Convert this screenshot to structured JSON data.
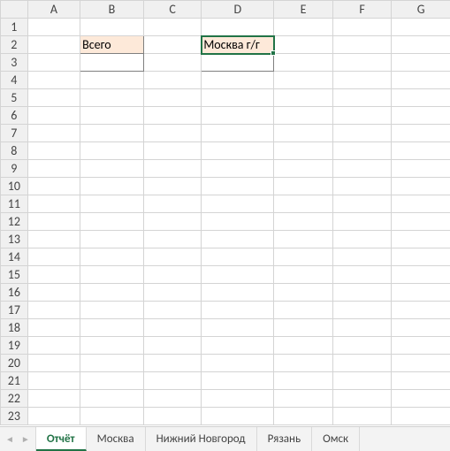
{
  "columns": [
    "A",
    "B",
    "C",
    "D",
    "E",
    "F",
    "G"
  ],
  "row_count": 23,
  "cells": {
    "B2": "Всего",
    "D2": "Москва г/г"
  },
  "active_cell": "D2",
  "tabs": {
    "items": [
      "Отчёт",
      "Москва",
      "Нижний Новгород",
      "Рязань",
      "Омск"
    ],
    "active_index": 0
  },
  "nav": {
    "prev": "◄",
    "next": "►"
  }
}
